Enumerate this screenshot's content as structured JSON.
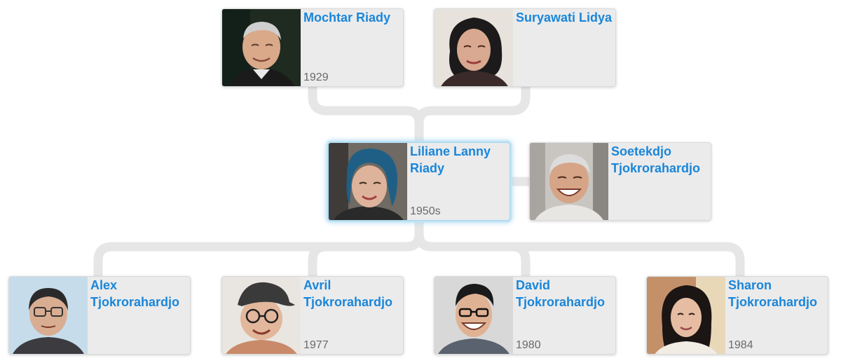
{
  "colors": {
    "name": "#1a86d9",
    "year": "#6a6a6a",
    "card": "#ebebeb",
    "connector": "#e6e6e6"
  },
  "people": {
    "mochtar": {
      "name": "Mochtar Riady",
      "year": "1929",
      "photo": "portrait-elderly-man"
    },
    "suryawati": {
      "name": "Suryawati Lidya",
      "year": "",
      "photo": "portrait-elderly-woman"
    },
    "liliane": {
      "name": "Liliane Lanny Riady",
      "year": "1950s",
      "photo": "portrait-woman-blue-headscarf"
    },
    "soetekdjo": {
      "name": "Soetekdjo Tjokrorahardjo",
      "year": "",
      "photo": "portrait-smiling-older-man"
    },
    "alex": {
      "name": "Alex Tjokrorahardjo",
      "year": "",
      "photo": "portrait-man-glasses"
    },
    "avril": {
      "name": "Avril Tjokrorahardjo",
      "year": "1977",
      "photo": "portrait-woman-cap-glasses"
    },
    "david": {
      "name": "David Tjokrorahardjo",
      "year": "1980",
      "photo": "portrait-man-glasses-smiling"
    },
    "sharon": {
      "name": "Sharon Tjokrorahardjo",
      "year": "1984",
      "photo": "portrait-young-woman"
    }
  }
}
